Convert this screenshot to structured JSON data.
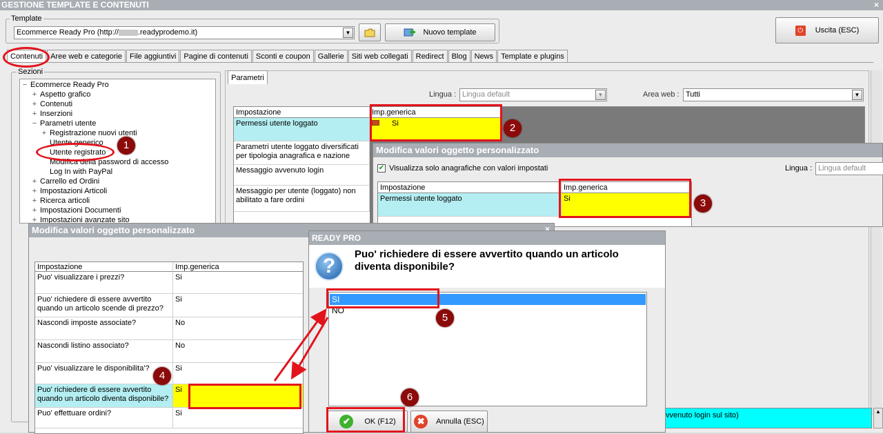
{
  "window": {
    "title": "GESTIONE TEMPLATE E CONTENUTI",
    "close_glyph": "×"
  },
  "template": {
    "group_label": "Template",
    "combo_value_prefix": "Ecommerce Ready Pro (http://",
    "combo_value_suffix": ".readyprodemo.it)",
    "new_button": "Nuovo template",
    "exit_button": "Uscita (ESC)"
  },
  "tabs": [
    "Contenuti",
    "Aree web e categorie",
    "File aggiuntivi",
    "Pagine di contenuti",
    "Sconti e coupon",
    "Gallerie",
    "Siti web collegati",
    "Redirect",
    "Blog",
    "News",
    "Template e plugins"
  ],
  "sezioni": {
    "label": "Sezioni",
    "nodes": [
      {
        "indent": 0,
        "pm": "−",
        "label": "Ecommerce Ready Pro"
      },
      {
        "indent": 1,
        "pm": "+",
        "label": "Aspetto grafico"
      },
      {
        "indent": 1,
        "pm": "+",
        "label": "Contenuti"
      },
      {
        "indent": 1,
        "pm": "+",
        "label": "Inserzioni"
      },
      {
        "indent": 1,
        "pm": "−",
        "label": "Parametri utente"
      },
      {
        "indent": 2,
        "pm": "+",
        "label": "Registrazione nuovi utenti"
      },
      {
        "indent": 2,
        "pm": "",
        "label": "Utente generico"
      },
      {
        "indent": 2,
        "pm": "",
        "label": "Utente registrato"
      },
      {
        "indent": 2,
        "pm": "",
        "label": "Modifica della password di accesso"
      },
      {
        "indent": 2,
        "pm": "",
        "label": "Log In with PayPal"
      },
      {
        "indent": 1,
        "pm": "+",
        "label": "Carrello ed Ordini"
      },
      {
        "indent": 1,
        "pm": "+",
        "label": "Impostazioni Articoli"
      },
      {
        "indent": 1,
        "pm": "+",
        "label": "Ricerca articoli"
      },
      {
        "indent": 1,
        "pm": "+",
        "label": "Impostazioni Documenti"
      },
      {
        "indent": 1,
        "pm": "+",
        "label": "Impostazioni avanzate sito"
      }
    ]
  },
  "parametri": {
    "tab": "Parametri",
    "lingua_label": "Lingua :",
    "lingua_value": "Lingua default",
    "area_label": "Area web :",
    "area_value": "Tutti",
    "col_impostazione": "Impostazione",
    "col_imp": "Imp.generica",
    "rows": [
      {
        "label": "Permessi utente loggato",
        "value": "Si"
      },
      {
        "label": "Parametri utente loggato diversificati per tipologia anagrafica e nazione",
        "value": ""
      },
      {
        "label": "Messaggio avvenuto login",
        "value": ""
      },
      {
        "label": "Messaggio per utente (loggato) non abilitato a fare ordini",
        "value": ""
      }
    ],
    "bottom_text": "vvenuto login sul sito)"
  },
  "dialog_right": {
    "title": "Modifica valori oggetto personalizzato",
    "checkbox_label": "Visualizza solo anagrafiche con valori impostati",
    "lingua_label": "Lingua :",
    "lingua_value": "Lingua default",
    "col_impostazione": "Impostazione",
    "col_imp": "Imp.generica",
    "row_label": "Permessi utente loggato",
    "row_value": "Si"
  },
  "dialog_left": {
    "title": "Modifica valori oggetto personalizzato",
    "col_impostazione": "Impostazione",
    "col_imp": "Imp.generica",
    "rows": [
      {
        "label": "Puo' visualizzare i prezzi?",
        "value": "Si"
      },
      {
        "label": "Puo' richiedere di essere avvertito quando un articolo scende di prezzo?",
        "value": "Si"
      },
      {
        "label": "Nascondi imposte associate?",
        "value": "No"
      },
      {
        "label": "Nascondi listino associato?",
        "value": "No"
      },
      {
        "label": "Puo' visualizzare le disponibilita'?",
        "value": "Si"
      },
      {
        "label": "Puo' richiedere di essere avvertito quando un articolo diventa disponibile?",
        "value": "Si"
      },
      {
        "label": "Puo' effettuare ordini?",
        "value": "Si"
      }
    ]
  },
  "ready_pro": {
    "title": "READY PRO",
    "question": "Puo' richiedere di essere avvertito quando un articolo diventa disponibile?",
    "options": [
      "SI",
      "NO"
    ],
    "selected": "SI",
    "ok_button": "OK (F12)",
    "cancel_button": "Annulla (ESC)"
  },
  "badges": [
    "1",
    "2",
    "3",
    "4",
    "5",
    "6"
  ],
  "colors": {
    "annotation_red": "#e3131b",
    "highlight_yellow": "#ffff00",
    "row_cyan": "#b4eef2",
    "selection_blue": "#3399ff"
  }
}
